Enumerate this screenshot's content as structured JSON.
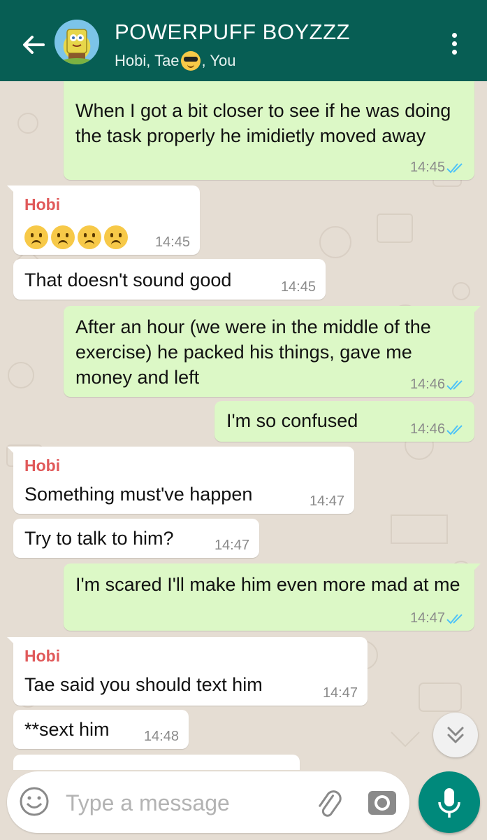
{
  "header": {
    "title": "POWERPUFF BOYZZZ",
    "members_prefix": "Hobi, Tae",
    "members_suffix": ", You"
  },
  "messages": [
    {
      "id": "m1",
      "dir": "out",
      "text": "When I got a bit closer to see if he was doing the task properly he imidietly moved away",
      "time": "14:45",
      "ticks": "read"
    },
    {
      "id": "m2",
      "dir": "in",
      "sender": "Hobi",
      "emoji_count": 4,
      "emoji": "frowning-face",
      "time": "14:45"
    },
    {
      "id": "m3",
      "dir": "in",
      "text": "That doesn't sound good",
      "time": "14:45"
    },
    {
      "id": "m4",
      "dir": "out",
      "text": "After an hour (we were in the middle of the exercise) he packed his things, gave me money and left",
      "time": "14:46",
      "ticks": "read"
    },
    {
      "id": "m5",
      "dir": "out",
      "text": "I'm so confused",
      "time": "14:46",
      "ticks": "read"
    },
    {
      "id": "m6",
      "dir": "in",
      "sender": "Hobi",
      "text": "Something must've happen",
      "time": "14:47"
    },
    {
      "id": "m7",
      "dir": "in",
      "text": "Try to talk to him?",
      "time": "14:47"
    },
    {
      "id": "m8",
      "dir": "out",
      "text": "I'm scared I'll make him even more mad at me",
      "time": "14:47",
      "ticks": "read"
    },
    {
      "id": "m9",
      "dir": "in",
      "sender": "Hobi",
      "text": "Tae said you should text him",
      "time": "14:47"
    },
    {
      "id": "m10",
      "dir": "in",
      "text": "**sext him",
      "time": "14:48"
    }
  ],
  "composer": {
    "placeholder": "Type a message"
  },
  "colors": {
    "header": "#075e54",
    "outgoing_bubble": "#dcf8c6",
    "incoming_bubble": "#ffffff",
    "sender_name": "#e0595a",
    "read_ticks": "#4fc3f7",
    "mic_button": "#00897b"
  },
  "icons": {
    "back": "back-arrow-icon",
    "menu": "more-vert-icon",
    "scroll": "chevron-double-down-icon",
    "emoji": "smiley-icon",
    "attach": "paperclip-icon",
    "camera": "camera-icon",
    "mic": "microphone-icon"
  }
}
